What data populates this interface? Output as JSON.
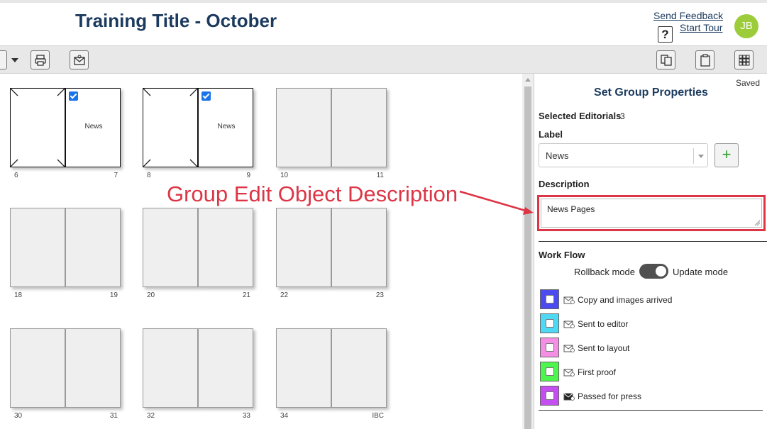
{
  "header": {
    "title": "Training Title - October",
    "send_feedback": "Send Feedback",
    "start_tour": "Start Tour",
    "help": "?",
    "avatar_initials": "JB"
  },
  "toolbar": {
    "left_buttons": [
      "layout-dropdown",
      "print-icon",
      "email-icon"
    ],
    "right_buttons": [
      "copy-pages-icon",
      "clipboard-icon",
      "grid-view-icon"
    ]
  },
  "spreads": [
    {
      "left": "6",
      "right": "7",
      "selected": true,
      "label": "News"
    },
    {
      "left": "8",
      "right": "9",
      "selected": true,
      "label": "News"
    },
    {
      "left": "10",
      "right": "11",
      "selected": false,
      "label": ""
    },
    {
      "left": "18",
      "right": "19",
      "selected": false,
      "label": ""
    },
    {
      "left": "20",
      "right": "21",
      "selected": false,
      "label": ""
    },
    {
      "left": "22",
      "right": "23",
      "selected": false,
      "label": ""
    },
    {
      "left": "30",
      "right": "31",
      "selected": false,
      "label": ""
    },
    {
      "left": "32",
      "right": "33",
      "selected": false,
      "label": ""
    },
    {
      "left": "34",
      "right": "IBC",
      "selected": false,
      "label": ""
    }
  ],
  "annotation": "Group Edit Object Description",
  "panel": {
    "saved": "Saved",
    "title": "Set Group Properties",
    "selected_label": "Selected Editorials",
    "selected_count": "3",
    "label_heading": "Label",
    "label_value": "News",
    "description_heading": "Description",
    "description_value": "News Pages",
    "workflow_heading": "Work Flow",
    "rollback_mode": "Rollback mode",
    "update_mode": "Update mode",
    "workflow_items": [
      {
        "label": "Copy and images arrived",
        "color": "#4b4bf0",
        "checked": false
      },
      {
        "label": "Sent to editor",
        "color": "#4fd8f4",
        "checked": false
      },
      {
        "label": "Sent to layout",
        "color": "#f58fe6",
        "checked": false
      },
      {
        "label": "First proof",
        "color": "#4ef54e",
        "checked": false
      },
      {
        "label": "Passed for press",
        "color": "#c54ef0",
        "checked": false
      }
    ]
  },
  "colors": {
    "accent_red": "#dc3545",
    "title_navy": "#1b3a5e",
    "avatar_green": "#9ccc3a"
  }
}
